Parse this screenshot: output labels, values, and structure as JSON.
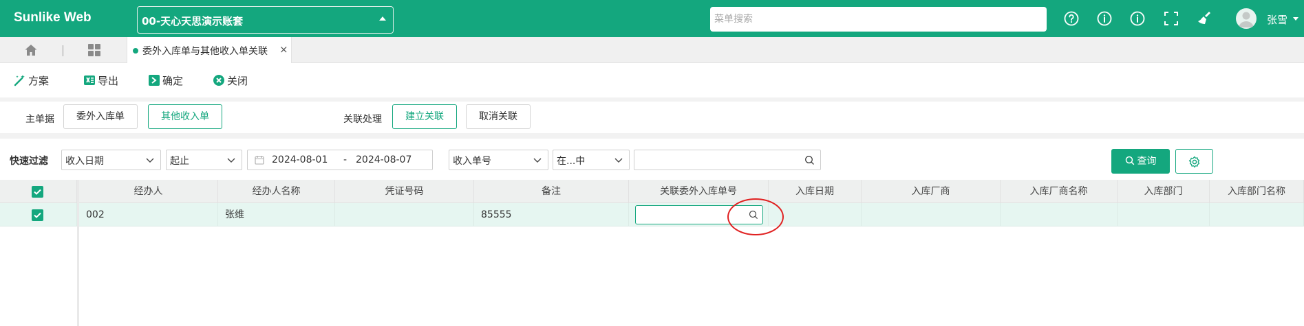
{
  "app": {
    "brand": "Sunlike Web",
    "account": "00-天心天思演示账套"
  },
  "topbar": {
    "search_placeholder": "菜单搜索",
    "icons": [
      "help-icon",
      "info-icon",
      "info-icon",
      "fullscreen-icon",
      "broom-icon"
    ],
    "username": "张雪"
  },
  "tabs": {
    "active": "委外入库单与其他收入单关联",
    "close": "×"
  },
  "toolbar": {
    "plan": "方案",
    "export": "导出",
    "confirm": "确定",
    "close": "关闭"
  },
  "relation": {
    "main_label": "主单据",
    "doc_a": "委外入库单",
    "doc_b": "其他收入单",
    "process_label": "关联处理",
    "build": "建立关联",
    "cancel": "取消关联"
  },
  "filter": {
    "label": "快速过滤",
    "field": "收入日期",
    "range": "起止",
    "date_from": "2024-08-01",
    "date_sep": "-",
    "date_to": "2024-08-07",
    "field2": "收入单号",
    "op": "在...中",
    "query": "查询"
  },
  "grid": {
    "columns": [
      "经办人",
      "经办人名称",
      "凭证号码",
      "备注",
      "关联委外入库单号",
      "入库日期",
      "入库厂商",
      "入库厂商名称",
      "入库部门",
      "入库部门名称"
    ],
    "rows": [
      {
        "checked": true,
        "cells": [
          "002",
          "张维",
          "",
          "85555",
          "",
          "",
          "",
          "",
          "",
          ""
        ]
      }
    ]
  },
  "colors": {
    "accent": "#14a77e",
    "row_selected": "#e6f6f1",
    "annotation": "#e02020"
  }
}
